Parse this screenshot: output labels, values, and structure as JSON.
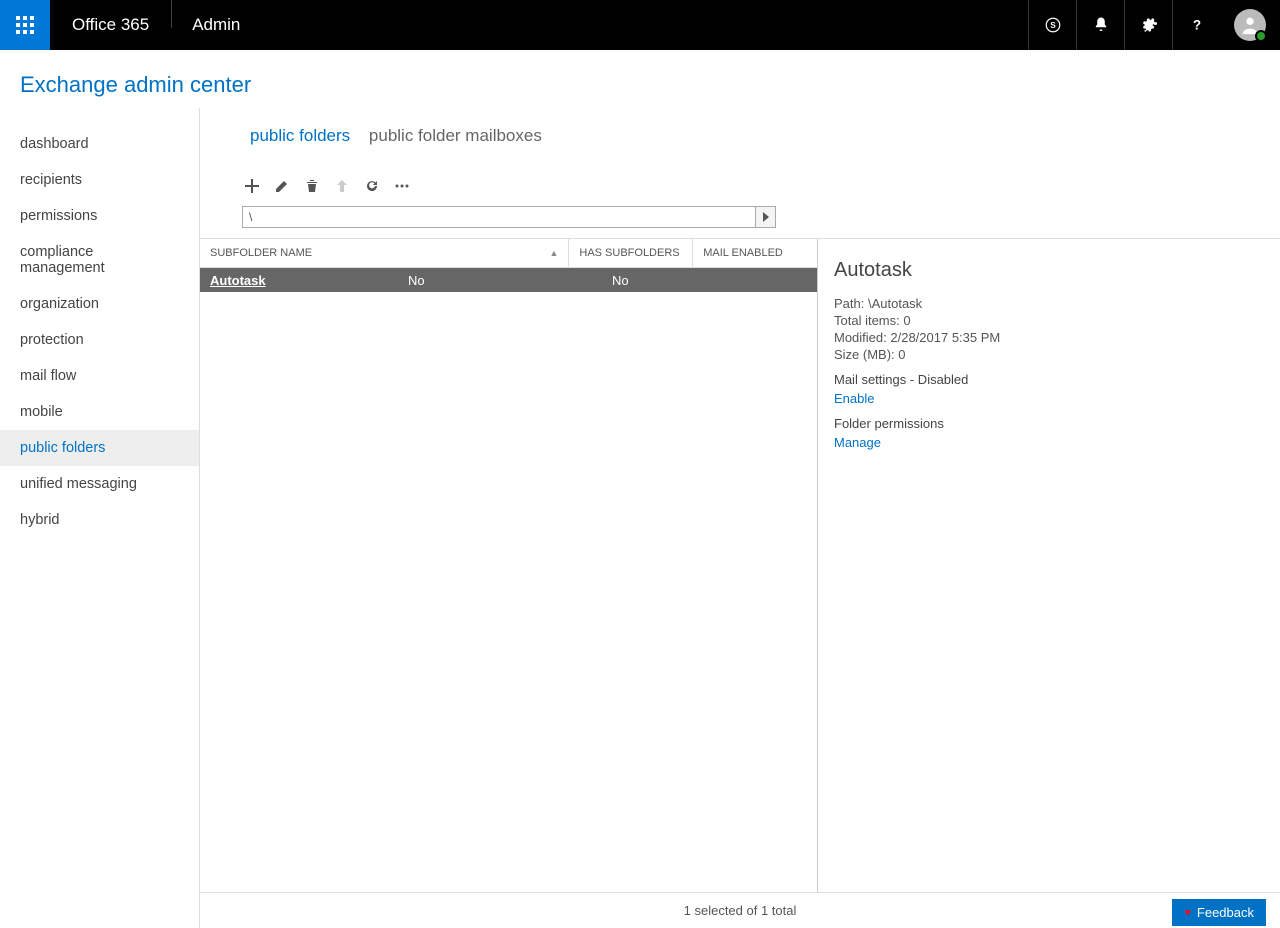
{
  "header": {
    "brand": "Office 365",
    "module": "Admin"
  },
  "page_title": "Exchange admin center",
  "sidebar": {
    "items": [
      {
        "label": "dashboard"
      },
      {
        "label": "recipients"
      },
      {
        "label": "permissions"
      },
      {
        "label": "compliance management"
      },
      {
        "label": "organization"
      },
      {
        "label": "protection"
      },
      {
        "label": "mail flow"
      },
      {
        "label": "mobile"
      },
      {
        "label": "public folders"
      },
      {
        "label": "unified messaging"
      },
      {
        "label": "hybrid"
      }
    ],
    "active_index": 8
  },
  "tabs": {
    "items": [
      {
        "label": "public folders"
      },
      {
        "label": "public folder mailboxes"
      }
    ],
    "active_index": 0
  },
  "path": "\\",
  "grid": {
    "columns": [
      {
        "label": "SUBFOLDER NAME",
        "sorted": "asc"
      },
      {
        "label": "HAS SUBFOLDERS"
      },
      {
        "label": "MAIL ENABLED"
      }
    ],
    "rows": [
      {
        "name": "Autotask",
        "has_subfolders": "No",
        "mail_enabled": "No"
      }
    ]
  },
  "details": {
    "title": "Autotask",
    "path_label": "Path:",
    "path_value": "\\Autotask",
    "total_items_label": "Total items:",
    "total_items_value": "0",
    "modified_label": "Modified:",
    "modified_value": "2/28/2017 5:35 PM",
    "size_label": "Size (MB):",
    "size_value": "0",
    "mail_settings_label": "Mail settings - Disabled",
    "enable_link": "Enable",
    "permissions_label": "Folder permissions",
    "manage_link": "Manage"
  },
  "footer": {
    "status": "1 selected of 1 total",
    "feedback_label": "Feedback"
  }
}
